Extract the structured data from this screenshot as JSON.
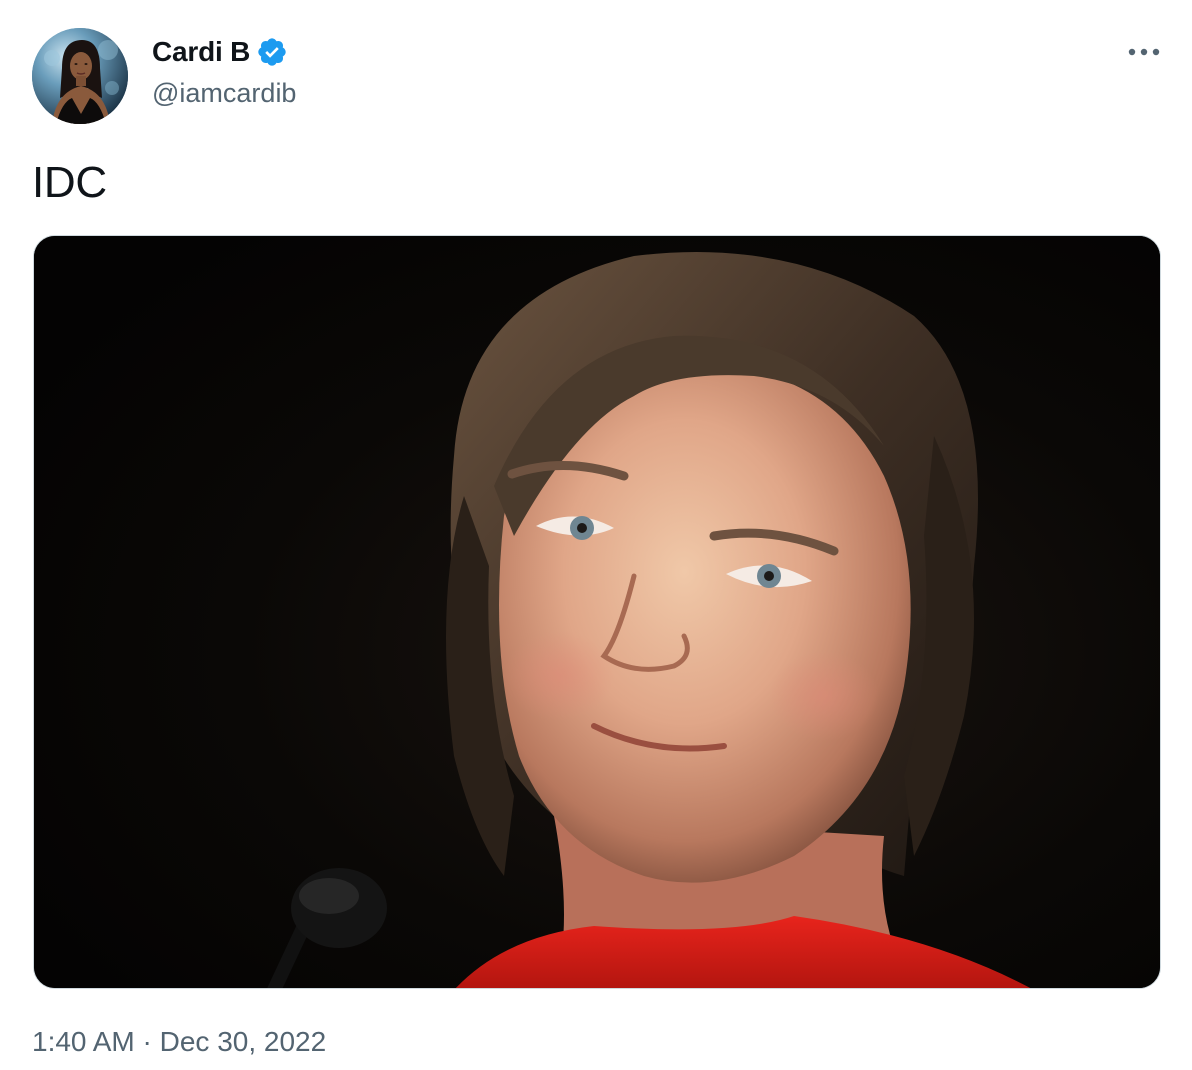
{
  "author": {
    "display_name": "Cardi B",
    "handle": "@iamcardib",
    "verified": true,
    "verified_color": "#1d9bf0"
  },
  "tweet": {
    "text": "IDC"
  },
  "meta": {
    "time": "1:40 AM",
    "separator": " · ",
    "date": "Dec 30, 2022"
  },
  "icons": {
    "more": "more-horizontal-icon",
    "verified": "verified-badge-icon"
  },
  "colors": {
    "text_primary": "#0f1419",
    "text_secondary": "#536471",
    "border": "#cfd9de"
  }
}
